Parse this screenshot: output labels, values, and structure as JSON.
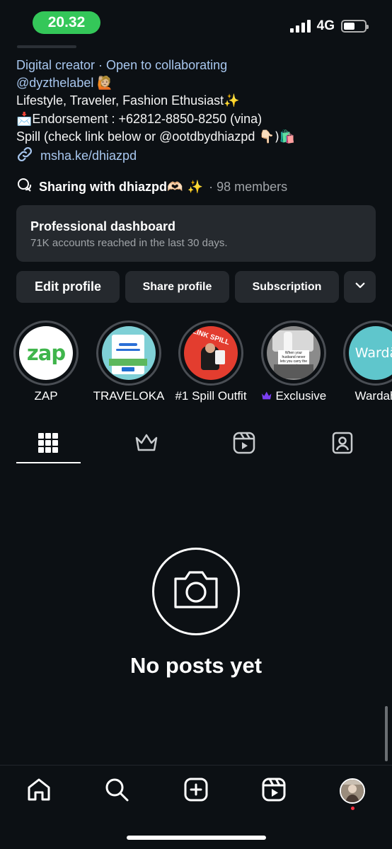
{
  "status_bar": {
    "time": "20.32",
    "network": "4G",
    "battery_level": 0.55,
    "time_pill_color": "#34c759"
  },
  "bio": {
    "category": "Digital creator",
    "separator": " · ",
    "collab": "Open to collaborating",
    "handle": "@dyzthelabel",
    "handle_emoji": "🙋🏼",
    "line3": "Lifestyle, Traveler, Fashion Ethusiast",
    "line3_emoji": "✨",
    "line4_emoji": "📩",
    "line4": "Endorsement : +62812-8850-8250 (vina)",
    "line5": "Spill (check link below or @ootdbydhiazpd ",
    "line5_emoji": "👇🏻)🛍️",
    "website": "msha.ke/dhiazpd",
    "link_color": "#a8c7ef"
  },
  "channel": {
    "name": "Sharing with dhiazpd",
    "name_emoji": "🫶🏻 ✨",
    "members": "· 98 members"
  },
  "dashboard": {
    "title": "Professional dashboard",
    "subtitle": "71K accounts reached in the last 30 days."
  },
  "buttons": {
    "edit": "Edit profile",
    "share": "Share profile",
    "subscription": "Subscription"
  },
  "highlights": [
    {
      "label": "ZAP",
      "icon": "zap-logo"
    },
    {
      "label": "TRAVELOKA",
      "icon": "traveloka-thumbnail"
    },
    {
      "label": "#1 Spill Outfit",
      "icon": "spill-outfit-thumbnail",
      "thumb_text": "LINK SPILL"
    },
    {
      "label": "Exclusive",
      "icon": "crown-icon",
      "thumb_text": "When your husband never lets you carry the groceries"
    },
    {
      "label": "Wardah",
      "icon": "wardah-logo",
      "thumb_text": "Wardā"
    }
  ],
  "zap_logo_text": "zap",
  "tabs": [
    {
      "name": "grid-icon",
      "active": true
    },
    {
      "name": "crown-icon",
      "active": false
    },
    {
      "name": "reels-icon",
      "active": false
    },
    {
      "name": "tagged-icon",
      "active": false
    }
  ],
  "empty_state": {
    "title": "No posts yet"
  },
  "bottom_nav": [
    {
      "name": "home-icon"
    },
    {
      "name": "search-icon"
    },
    {
      "name": "create-icon"
    },
    {
      "name": "reels-icon"
    },
    {
      "name": "profile-avatar"
    }
  ],
  "colors": {
    "background": "#0c1014",
    "card": "#25292e",
    "crown_purple": "#7b3ff2",
    "zap_green": "#3fb54b",
    "wardah_teal": "#5fc6cc"
  }
}
